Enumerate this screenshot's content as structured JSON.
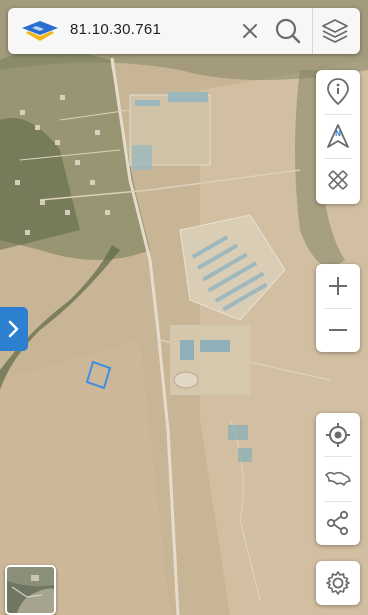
{
  "search": {
    "coordinates": "81.10.30.761",
    "logo_icon": "diamond-logo-icon",
    "clear_icon": "close-icon",
    "search_icon": "search-icon",
    "layers_icon": "layers-icon"
  },
  "tools": [
    "info-icon",
    "compass-north-icon",
    "measure-icon"
  ],
  "zoom": [
    "plus-icon",
    "minus-icon"
  ],
  "actions": [
    "locate-icon",
    "route-icon",
    "share-icon"
  ],
  "settings_icon": "gear-icon",
  "side_tab_icon": "chevron-right-icon",
  "compass_label": "N",
  "colors": {
    "accent": "#2d7fd0",
    "logo_blue": "#2a6fcf",
    "logo_yellow": "#f2b51c",
    "icon_gray": "#6b6b6b",
    "terrain": "#c9b79a",
    "vegetation": "#6f7a55",
    "roof": "#8fb0b8"
  }
}
